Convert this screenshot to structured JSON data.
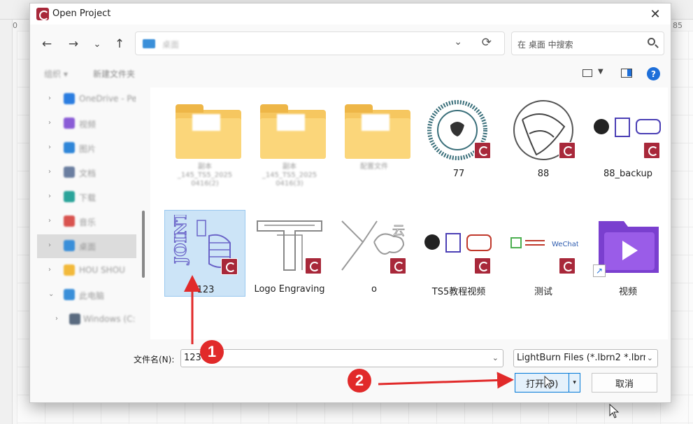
{
  "background": {
    "ruler_left_zero": "0",
    "ruler_right_num": "85"
  },
  "dialog": {
    "title": "Open Project",
    "close_glyph": "✕",
    "nav": {
      "back": "←",
      "forward": "→",
      "recent": "⌄",
      "up": "↑"
    },
    "address": {
      "path_text": "桌面",
      "refresh": "⟳",
      "dropdown": "⌄"
    },
    "search": {
      "placeholder": "在 桌面 中搜索"
    },
    "toolbar": {
      "organize": "组织 ▾",
      "new_folder": "新建文件夹",
      "help": "?"
    },
    "sidebar": {
      "items": [
        {
          "label": "OneDrive - Pe",
          "color": "#2b7de0"
        },
        {
          "label": "视频",
          "color": "#8a5cd6"
        },
        {
          "label": "图片",
          "color": "#2f86d8"
        },
        {
          "label": "文档",
          "color": "#6a7ea0"
        },
        {
          "label": "下载",
          "color": "#2aa49a"
        },
        {
          "label": "音乐",
          "color": "#d9534f"
        },
        {
          "label": "桌面",
          "color": "#3a8fd9"
        },
        {
          "label": "HOU SHOU",
          "color": "#f2b93b"
        },
        {
          "label": "此电脑",
          "color": "#3a8fd9"
        },
        {
          "label": "Windows (C:",
          "color": "#5a6b80"
        }
      ]
    },
    "files": [
      {
        "name": "副本\n_145_TS5_2025\n0416(2)",
        "kind": "folder",
        "blur": true
      },
      {
        "name": "副本\n_145_TS5_2025\n0416(3)",
        "kind": "folder",
        "blur": true
      },
      {
        "name": "配置文件",
        "kind": "folder",
        "blur": true
      },
      {
        "name": "77",
        "kind": "lbrn-circle"
      },
      {
        "name": "88",
        "kind": "lbrn-phoenix"
      },
      {
        "name": "88_backup",
        "kind": "lbrn-multi"
      },
      {
        "name": "123",
        "kind": "lbrn-joint",
        "selected": true
      },
      {
        "name": "Logo Engraving",
        "kind": "lbrn-logo"
      },
      {
        "name": "o",
        "kind": "lbrn-cloud"
      },
      {
        "name": "TS5教程视频",
        "kind": "lbrn-multi2"
      },
      {
        "name": "测试",
        "kind": "lbrn-test"
      },
      {
        "name": "视频",
        "kind": "video-shortcut"
      }
    ],
    "footer": {
      "filename_label": "文件名(N):",
      "filename_value": "123",
      "filter_value": "LightBurn Files (*.lbrn2 *.lbrn",
      "open_label": "打开(O)",
      "open_split": "▾",
      "cancel_label": "取消"
    }
  },
  "annotations": {
    "callout_1": "1",
    "callout_2": "2",
    "color": "#e12a2a"
  }
}
